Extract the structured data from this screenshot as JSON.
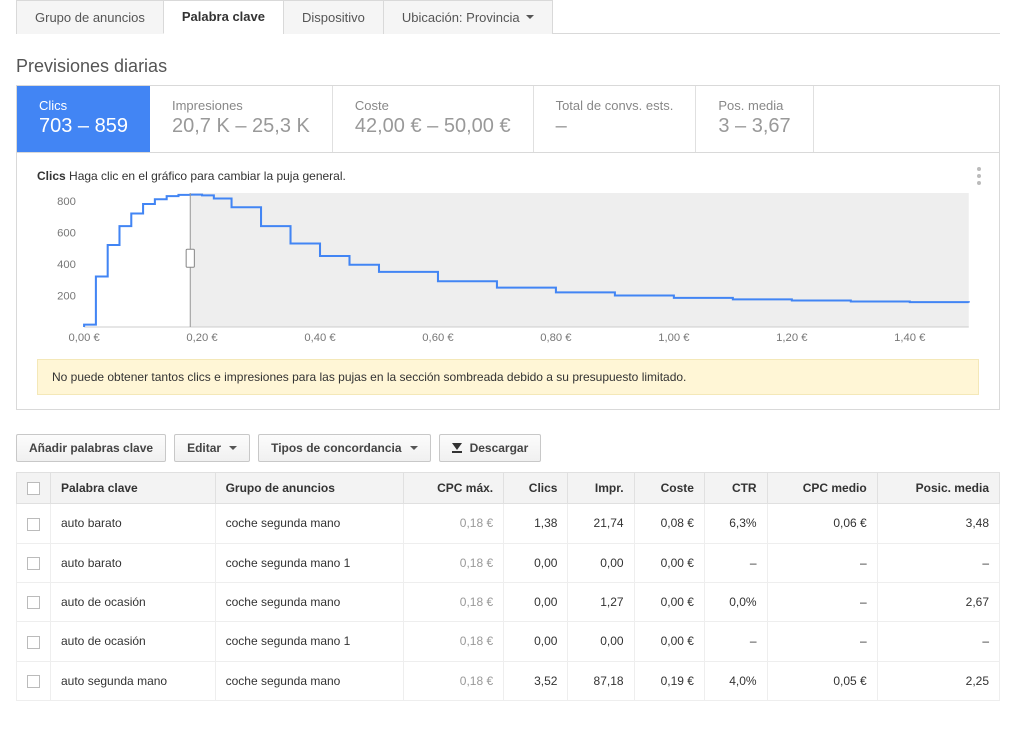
{
  "tabs": [
    {
      "label": "Grupo de anuncios",
      "active": false
    },
    {
      "label": "Palabra clave",
      "active": true
    },
    {
      "label": "Dispositivo",
      "active": false
    },
    {
      "label": "Ubicación: Provincia",
      "active": false,
      "dropdown": true
    }
  ],
  "section_title": "Previsiones diarias",
  "metrics": [
    {
      "label": "Clics",
      "value": "703 – 859",
      "active": true
    },
    {
      "label": "Impresiones",
      "value": "20,7 K – 25,3 K",
      "active": false
    },
    {
      "label": "Coste",
      "value": "42,00 € – 50,00 €",
      "active": false
    },
    {
      "label": "Total de convs. ests.",
      "value": "–",
      "active": false
    },
    {
      "label": "Pos. media",
      "value": "3 – 3,67",
      "active": false
    }
  ],
  "chart": {
    "bold": "Clics",
    "rest": " Haga clic en el gráfico para cambiar la puja general."
  },
  "warning": "No puede obtener tantos clics e impresiones para las pujas en la sección sombreada debido a su presupuesto limitado.",
  "toolbar": {
    "add_kw": "Añadir palabras clave",
    "edit": "Editar",
    "match": "Tipos de concordancia",
    "download": "Descargar"
  },
  "table": {
    "headers": {
      "kw": "Palabra clave",
      "grp": "Grupo de anuncios",
      "cpc": "CPC máx.",
      "clics": "Clics",
      "impr": "Impr.",
      "coste": "Coste",
      "ctr": "CTR",
      "cpcm": "CPC medio",
      "pos": "Posic. media"
    },
    "rows": [
      {
        "kw": "auto barato",
        "grp": "coche segunda mano",
        "cpc": "0,18 €",
        "clics": "1,38",
        "impr": "21,74",
        "coste": "0,08 €",
        "ctr": "6,3%",
        "cpcm": "0,06 €",
        "pos": "3,48"
      },
      {
        "kw": "auto barato",
        "grp": "coche segunda mano 1",
        "cpc": "0,18 €",
        "clics": "0,00",
        "impr": "0,00",
        "coste": "0,00 €",
        "ctr": "–",
        "cpcm": "–",
        "pos": "–"
      },
      {
        "kw": "auto de ocasión",
        "grp": "coche segunda mano",
        "cpc": "0,18 €",
        "clics": "0,00",
        "impr": "1,27",
        "coste": "0,00 €",
        "ctr": "0,0%",
        "cpcm": "–",
        "pos": "2,67"
      },
      {
        "kw": "auto de ocasión",
        "grp": "coche segunda mano 1",
        "cpc": "0,18 €",
        "clics": "0,00",
        "impr": "0,00",
        "coste": "0,00 €",
        "ctr": "–",
        "cpcm": "–",
        "pos": "–"
      },
      {
        "kw": "auto segunda mano",
        "grp": "coche segunda mano",
        "cpc": "0,18 €",
        "clics": "3,52",
        "impr": "87,18",
        "coste": "0,19 €",
        "ctr": "4,0%",
        "cpcm": "0,05 €",
        "pos": "2,25"
      }
    ]
  },
  "chart_data": {
    "type": "line",
    "xlabel": "",
    "ylabel": "",
    "xlim": [
      0,
      1.5
    ],
    "ylim": [
      0,
      850
    ],
    "x_ticks": [
      "0,00 €",
      "0,20 €",
      "0,40 €",
      "0,60 €",
      "0,80 €",
      "1,00 €",
      "1,20 €",
      "1,40 €"
    ],
    "y_ticks": [
      200,
      400,
      600,
      800
    ],
    "handle_x": 0.18,
    "shaded_from_x": 0.18,
    "x": [
      0.0,
      0.02,
      0.04,
      0.06,
      0.08,
      0.1,
      0.12,
      0.14,
      0.16,
      0.18,
      0.2,
      0.22,
      0.25,
      0.3,
      0.35,
      0.4,
      0.45,
      0.5,
      0.6,
      0.7,
      0.8,
      0.9,
      1.0,
      1.1,
      1.2,
      1.3,
      1.4,
      1.5
    ],
    "values": [
      15,
      320,
      520,
      640,
      720,
      780,
      810,
      830,
      838,
      840,
      835,
      815,
      760,
      640,
      530,
      450,
      395,
      350,
      290,
      250,
      220,
      200,
      185,
      175,
      168,
      162,
      158,
      155
    ]
  }
}
